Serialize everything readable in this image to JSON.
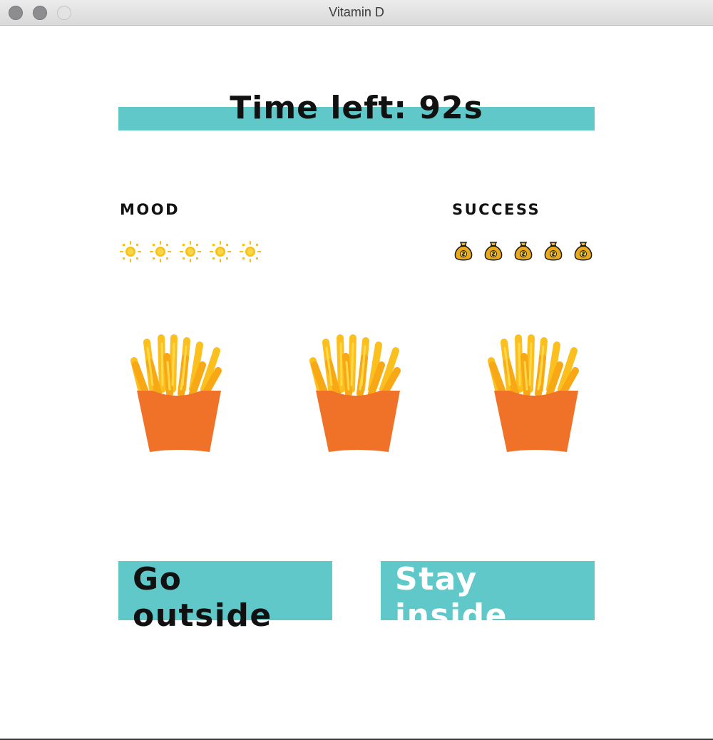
{
  "window": {
    "title": "Vitamin D"
  },
  "timer": {
    "text": "Time left: 92s"
  },
  "mood": {
    "label": "MOOD",
    "icon": "sun-icon",
    "count": 5
  },
  "success": {
    "label": "SUCCESS",
    "icon": "money-bag-icon",
    "count": 5
  },
  "scene": {
    "items": [
      "fries-icon",
      "fries-icon",
      "fries-icon"
    ]
  },
  "actions": {
    "go_outside": "Go outside",
    "stay_inside": "Stay inside"
  },
  "colors": {
    "accent": "#60c8c8",
    "sun": "#f9c012",
    "bag": "#e6a81a",
    "fries_box": "#f07228",
    "fries": "#fbb51a"
  }
}
